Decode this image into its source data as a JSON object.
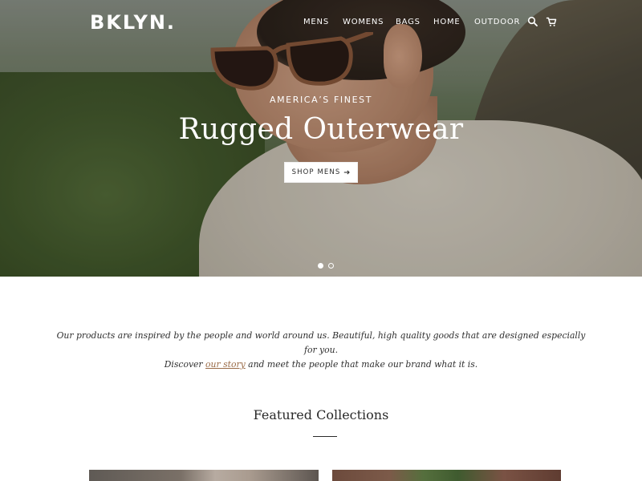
{
  "brand": {
    "logo_text": "BKLYN."
  },
  "nav": {
    "items": [
      {
        "label": "MENS"
      },
      {
        "label": "WOMENS"
      },
      {
        "label": "BAGS"
      },
      {
        "label": "HOME"
      },
      {
        "label": "OUTDOOR"
      }
    ],
    "icons": [
      "search-icon",
      "cart-icon"
    ]
  },
  "hero": {
    "eyebrow": "AMERICA’S FINEST",
    "title": "Rugged Outerwear",
    "cta_label": "SHOP MENS",
    "cta_icon": "arrow-right-icon",
    "slides": {
      "count": 2,
      "active_index": 0
    }
  },
  "intro": {
    "line1": "Our products are inspired by the people and world around us. Beautiful, high quality goods that are designed especially for you.",
    "line2_prefix": "Discover ",
    "link_text": "our story",
    "line2_suffix": " and meet the people that make our brand what it is."
  },
  "featured": {
    "title": "Featured Collections"
  },
  "colors": {
    "text_dark": "#2a2a2a",
    "link_brown": "#9a6b47",
    "white": "#ffffff"
  }
}
